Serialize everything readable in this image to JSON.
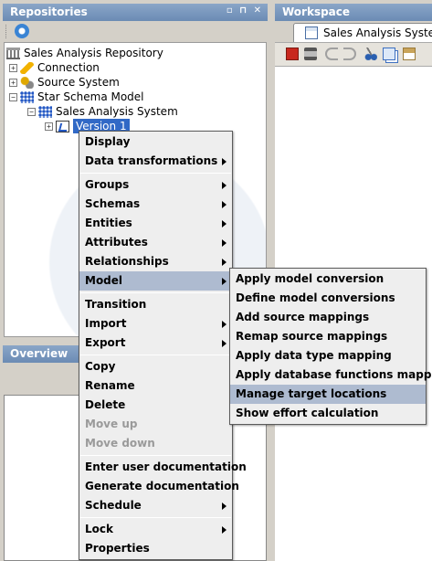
{
  "repositories": {
    "title": "Repositories",
    "controls": "▫⊞✕",
    "tree": [
      {
        "label": "Sales Analysis Repository",
        "icon": "bank-icon",
        "indent": 0
      },
      {
        "label": "Connection",
        "icon": "connection-icon",
        "indent": 1
      },
      {
        "label": "Source System",
        "icon": "source-system-icon",
        "indent": 1
      },
      {
        "label": "Star Schema Model",
        "icon": "star-schema-icon",
        "indent": 1
      },
      {
        "label": "Sales Analysis System",
        "icon": "model-grid-icon",
        "indent": 2
      },
      {
        "label": "Version 1",
        "icon": "version-icon",
        "indent": 3
      }
    ]
  },
  "overview": {
    "title": "Overview"
  },
  "workspace": {
    "title": "Workspace",
    "tab_label": "Sales Analysis System"
  },
  "context_menu": {
    "display": "Display",
    "data_transformations": "Data transformations",
    "groups": "Groups",
    "schemas": "Schemas",
    "entities": "Entities",
    "attributes": "Attributes",
    "relationships": "Relationships",
    "model": "Model",
    "transition": "Transition",
    "import": "Import",
    "export": "Export",
    "copy": "Copy",
    "rename": "Rename",
    "delete": "Delete",
    "move_up": "Move up",
    "move_down": "Move down",
    "enter_user_documentation": "Enter user documentation",
    "generate_documentation": "Generate documentation",
    "schedule": "Schedule",
    "lock": "Lock",
    "properties": "Properties"
  },
  "model_submenu": {
    "apply_model_conversion": "Apply model conversion",
    "define_model_conversions": "Define model conversions",
    "add_source_mappings": "Add source mappings",
    "remap_source_mappings": "Remap source mappings",
    "apply_data_type_mapping": "Apply data type mapping",
    "apply_database_functions_mapping": "Apply database functions mapping",
    "manage_target_locations": "Manage target locations",
    "show_effort_calculation": "Show effort calculation"
  }
}
